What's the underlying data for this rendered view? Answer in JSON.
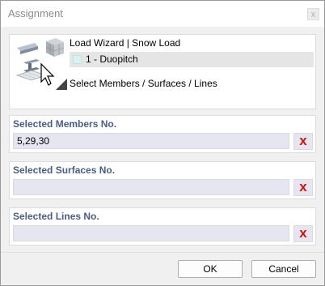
{
  "window": {
    "title": "Assignment",
    "close_glyph": "x"
  },
  "wizard": {
    "title": "Load Wizard | Snow Load",
    "selected": "1 - Duopitch",
    "swatch_color": "#d6f2f2",
    "subtitle": "Select Members / Surfaces / Lines",
    "icon": "load-wizard-icon"
  },
  "members": {
    "label": "Selected Members No.",
    "value": "5,29,30"
  },
  "surfaces": {
    "label": "Selected Surfaces No.",
    "value": ""
  },
  "lines": {
    "label": "Selected Lines No.",
    "value": ""
  },
  "clear_icon": "x",
  "clear_color": "#d01010",
  "buttons": {
    "ok": "OK",
    "cancel": "Cancel"
  }
}
